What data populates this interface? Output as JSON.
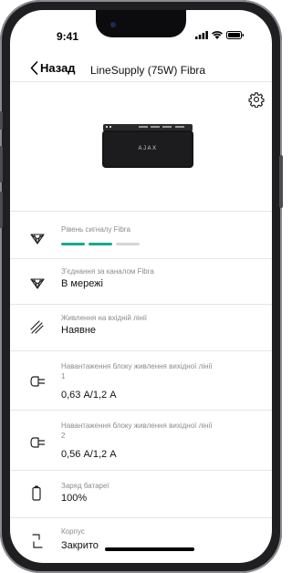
{
  "status_bar": {
    "time": "9:41"
  },
  "nav": {
    "back_label": "Назад",
    "title": "LineSupply (75W) Fibra"
  },
  "device": {
    "logo": "AJAX"
  },
  "rows": [
    {
      "label": "Рівень сигналу Fibra",
      "value": "",
      "icon": "signal-strength-icon",
      "signal_bars": 3,
      "signal_filled": 2
    },
    {
      "label": "З'єднання за каналом Fibra",
      "value": "В мережі",
      "icon": "fibra-connection-icon"
    },
    {
      "label": "Живлення на вхідній лінії",
      "value": "Наявне",
      "icon": "power-line-icon"
    },
    {
      "label_line1": "Навантаження блоку живлення вихідної лінії",
      "label_line2": "1",
      "value": "0,63 А/1,2 А",
      "icon": "plug-icon"
    },
    {
      "label_line1": "Навантаження блоку живлення вихідної лінії",
      "label_line2": "2",
      "value": "0,56 А/1,2 А",
      "icon": "plug-icon"
    },
    {
      "label": "Заряд батареї",
      "value": "100%",
      "icon": "battery-icon"
    },
    {
      "label": "Корпус",
      "value": "Закрито",
      "icon": "lid-icon"
    }
  ],
  "colors": {
    "accent": "#19a98f",
    "bar_inactive": "#d6d6d6"
  }
}
